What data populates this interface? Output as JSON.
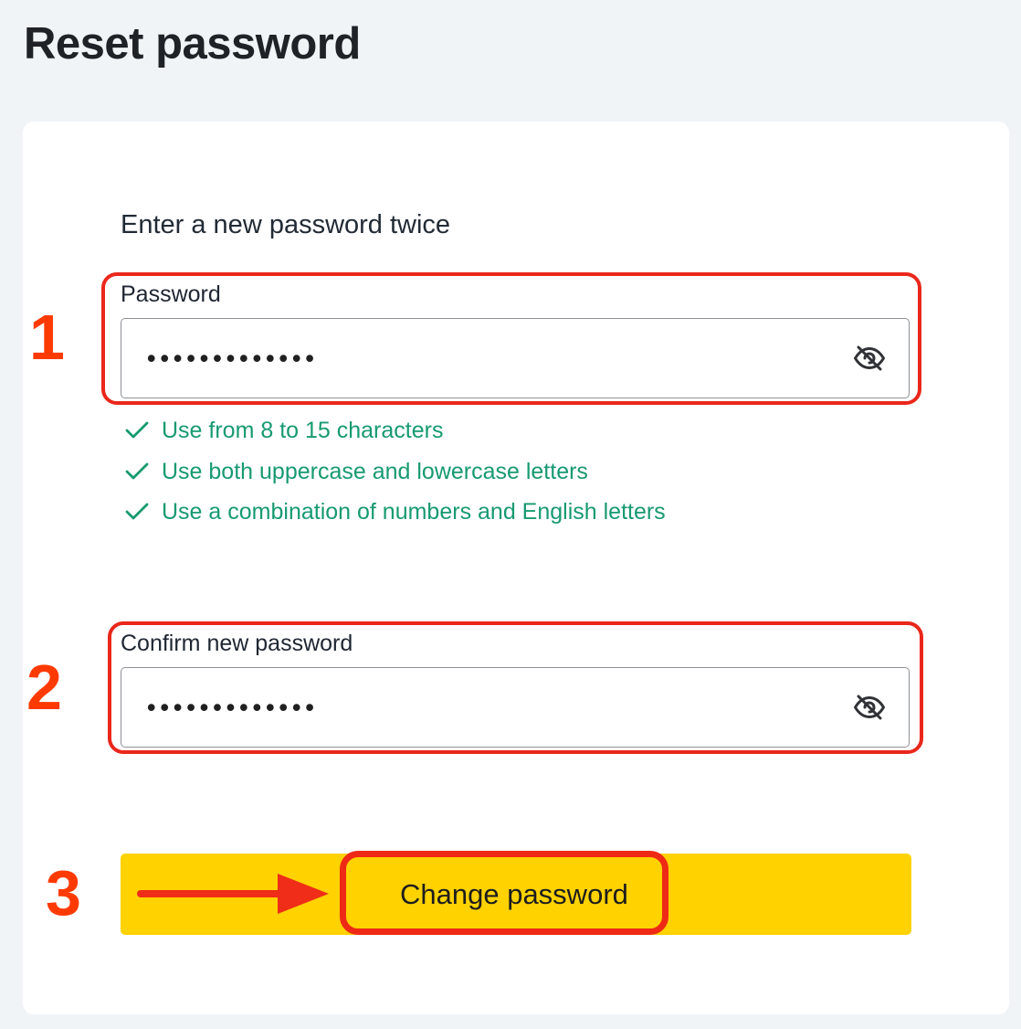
{
  "page": {
    "title": "Reset password"
  },
  "form": {
    "instruction": "Enter a new password twice",
    "password": {
      "label": "Password",
      "masked_value": "•••••••••••••",
      "visibility_icon": "eye-slash-icon"
    },
    "confirm_password": {
      "label": "Confirm new password",
      "masked_value": "•••••••••••••",
      "visibility_icon": "eye-slash-icon"
    },
    "requirements": [
      {
        "text": "Use from 8 to 15 characters",
        "status_icon": "check-icon"
      },
      {
        "text": "Use both uppercase and lowercase letters",
        "status_icon": "check-icon"
      },
      {
        "text": "Use a combination of numbers and English letters",
        "status_icon": "check-icon"
      }
    ],
    "submit": {
      "label": "Change password"
    }
  },
  "annotations": {
    "steps": [
      "1",
      "2",
      "3"
    ],
    "arrow_icon": "right-arrow-icon"
  },
  "colors": {
    "background": "#f1f4f7",
    "card": "#ffffff",
    "requirement_text": "#179a70",
    "primary_button": "#ffd200",
    "annotation": "#ea271b"
  }
}
